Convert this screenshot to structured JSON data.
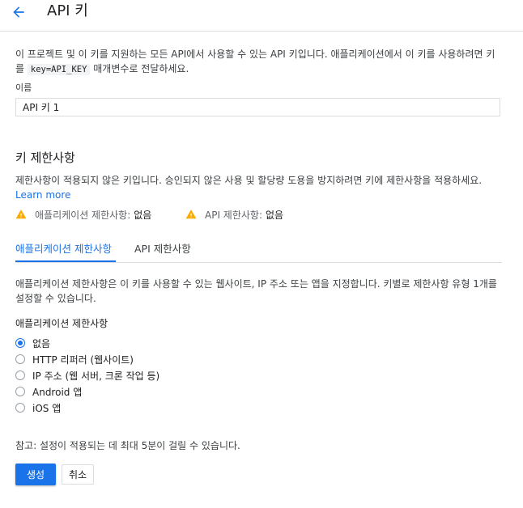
{
  "header": {
    "title": "API 키",
    "back_icon": "arrow-back-icon"
  },
  "intro": {
    "text_before": "이 프로젝트 및 이 키를 지원하는 모든 API에서 사용할 수 있는 API 키입니다. 애플리케이션에서 이 키를 사용하려면 키를",
    "code": "key=API_KEY",
    "text_after": "매개변수로 전달하세요."
  },
  "name_field": {
    "label": "이름",
    "value": "API 키 1"
  },
  "key_restrictions": {
    "title": "키 제한사항",
    "description": "제한사항이 적용되지 않은 키입니다. 승인되지 않은 사용 및 할당량 도용을 방지하려면 키에 제한사항을 적용하세요.",
    "learn_more": "Learn more",
    "warnings": [
      {
        "label": "애플리케이션 제한사항:",
        "value": "없음",
        "icon": "warning-icon"
      },
      {
        "label": "API 제한사항:",
        "value": "없음",
        "icon": "warning-icon"
      }
    ]
  },
  "tabs": [
    {
      "label": "애플리케이션 제한사항",
      "active": true
    },
    {
      "label": "API 제한사항",
      "active": false
    }
  ],
  "app_restrictions": {
    "description": "애플리케이션 제한사항은 이 키를 사용할 수 있는 웹사이트, IP 주소 또는 앱을 지정합니다. 키별로 제한사항 유형 1개를 설정할 수 있습니다.",
    "group_label": "애플리케이션 제한사항",
    "options": [
      {
        "label": "없음",
        "checked": true
      },
      {
        "label": "HTTP 리퍼러 (웹사이트)",
        "checked": false
      },
      {
        "label": "IP 주소 (웹 서버, 크론 작업 등)",
        "checked": false
      },
      {
        "label": "Android 앱",
        "checked": false
      },
      {
        "label": "iOS 앱",
        "checked": false
      }
    ]
  },
  "note": "참고: 설정이 적용되는 데 최대 5분이 걸릴 수 있습니다.",
  "actions": {
    "create_label": "생성",
    "cancel_label": "취소"
  },
  "colors": {
    "accent": "#1a73e8",
    "warning": "#f9ab00",
    "divider": "#dadce0"
  }
}
